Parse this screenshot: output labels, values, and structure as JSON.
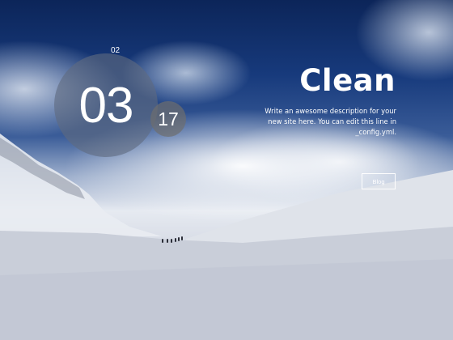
{
  "hero": {
    "month": "02",
    "day": "03",
    "year": "17",
    "title": "Clean",
    "description": "Write an awesome description for your new site here. You can edit this line in _config.yml.",
    "blog_button_label": "Blog"
  },
  "colors": {
    "sky_top": "#0c2559",
    "sky_mid": "#3a5c98",
    "snow": "#d2d7e2",
    "big_circle": "rgba(96,106,128,0.62)",
    "small_circle": "rgba(110,110,110,0.7)",
    "text": "#ffffff"
  }
}
